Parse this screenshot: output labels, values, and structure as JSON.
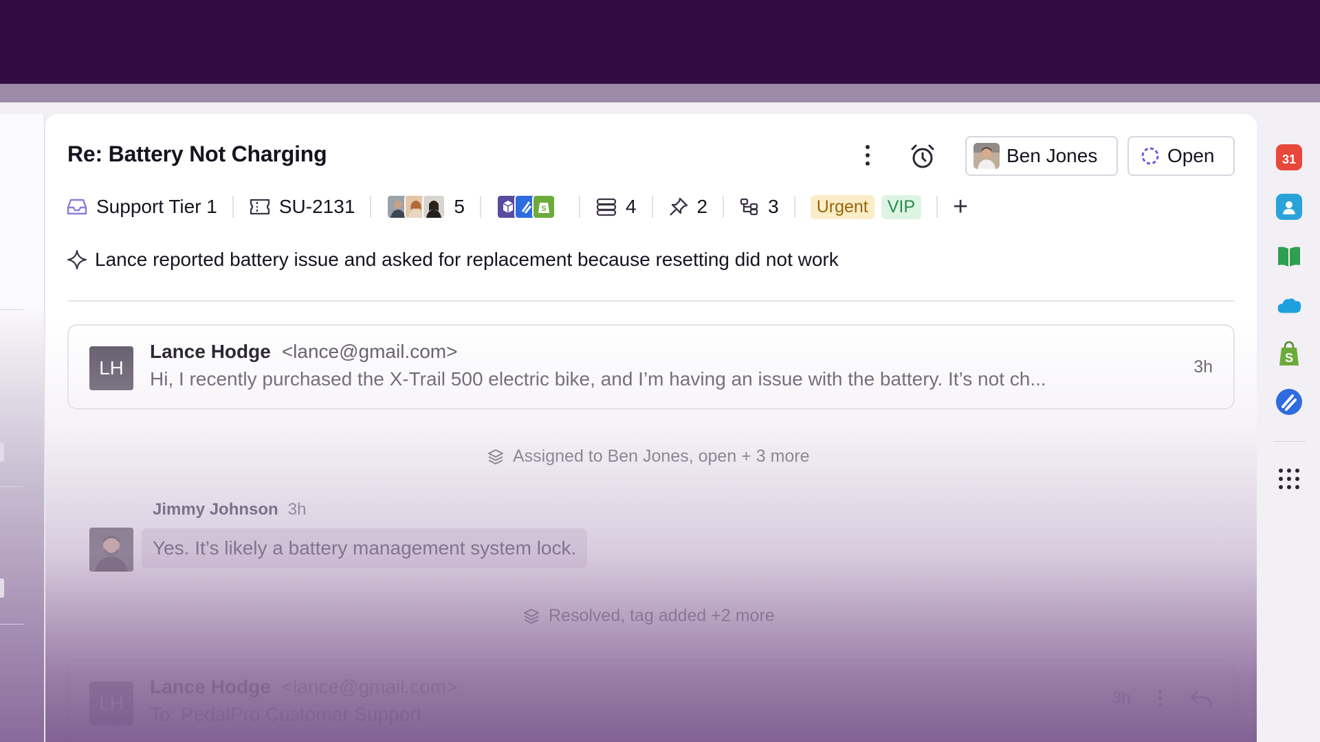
{
  "ticket": {
    "title": "Re: Battery Not Charging",
    "assignee": "Ben Jones",
    "status": "Open"
  },
  "meta": {
    "inbox": "Support Tier 1",
    "ticket_id": "SU-2131",
    "followers_count": "5",
    "apps_count": "",
    "fields_count": "4",
    "pinned_count": "2",
    "linked_count": "3",
    "tags": [
      "Urgent",
      "VIP"
    ],
    "add_label": "+"
  },
  "summary": "Lance reported battery issue and asked for replacement because resetting did not work",
  "messages": [
    {
      "initials": "LH",
      "name": "Lance Hodge",
      "email": "<lance@gmail.com>",
      "preview": "Hi, I recently purchased the X-Trail 500 electric bike, and I’m having an issue with the battery. It’s not ch...",
      "time": "3h"
    },
    {
      "initials": "LH",
      "name": "Lance Hodge",
      "email": "<lance@gmail.com>",
      "preview": "To: PedalPro Customer Support",
      "time": "3h"
    }
  ],
  "events": [
    "Assigned to Ben Jones, open + 3 more",
    "Resolved, tag added +2 more"
  ],
  "comment": {
    "author": "Jimmy Johnson",
    "time": "3h",
    "text": "Yes. It’s likely a battery management system lock."
  },
  "right_apps": [
    {
      "name": "calendar-icon",
      "label": "31",
      "color": "#e8473b"
    },
    {
      "name": "contact-icon",
      "label": "",
      "color": "#2aa3d8"
    },
    {
      "name": "book-icon",
      "label": "",
      "color": "#2f9e4f"
    },
    {
      "name": "salesforce-icon",
      "label": "",
      "color": "#1ea0dc"
    },
    {
      "name": "shopify-icon",
      "label": "",
      "color": "#6bab3c"
    },
    {
      "name": "linear-icon",
      "label": "",
      "color": "#2d6bde"
    }
  ],
  "colors": {
    "topbar": "#310c43",
    "urgent_bg": "#fbedc8",
    "vip_bg": "#ddf4e3",
    "status_ring": "#6a57e0"
  }
}
